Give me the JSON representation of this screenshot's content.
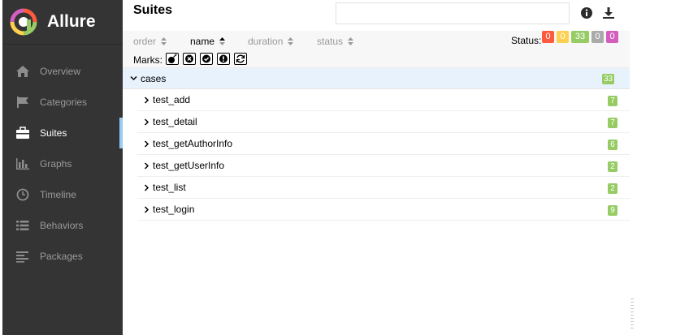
{
  "brand": {
    "name": "Allure"
  },
  "nav": [
    {
      "label": "Overview",
      "icon": "home-icon"
    },
    {
      "label": "Categories",
      "icon": "flag-icon"
    },
    {
      "label": "Suites",
      "icon": "briefcase-icon",
      "active": true
    },
    {
      "label": "Graphs",
      "icon": "bar-chart-icon"
    },
    {
      "label": "Timeline",
      "icon": "clock-icon"
    },
    {
      "label": "Behaviors",
      "icon": "list-icon"
    },
    {
      "label": "Packages",
      "icon": "align-left-icon"
    }
  ],
  "header": {
    "title": "Suites",
    "search_value": "",
    "info_icon": "info-icon",
    "download_icon": "download-icon"
  },
  "toolbar": {
    "sorters": [
      "order",
      "name",
      "duration",
      "status"
    ],
    "active_sorter": "name",
    "status_label": "Status:",
    "status_counts": [
      {
        "value": "0",
        "color": "#fd5a3e"
      },
      {
        "value": "0",
        "color": "#ffd050"
      },
      {
        "value": "33",
        "color": "#97cc64"
      },
      {
        "value": "0",
        "color": "#aaaaaa"
      },
      {
        "value": "0",
        "color": "#d35ebe"
      }
    ],
    "marks_label": "Marks:",
    "marks": [
      "bomb-icon",
      "times-circle-icon",
      "check-circle-icon",
      "exclamation-circle-icon",
      "refresh-icon"
    ]
  },
  "tree": {
    "group": {
      "name": "cases",
      "count": "33"
    },
    "items": [
      {
        "name": "test_add",
        "count": "7"
      },
      {
        "name": "test_detail",
        "count": "7"
      },
      {
        "name": "test_getAuthorInfo",
        "count": "6"
      },
      {
        "name": "test_getUserInfo",
        "count": "2"
      },
      {
        "name": "test_list",
        "count": "2"
      },
      {
        "name": "test_login",
        "count": "9"
      }
    ]
  },
  "colors": {
    "sidebar_bg": "#343434",
    "active_indicator": "#97cbf2",
    "passed": "#97cc64",
    "group_row_bg": "#e7f2fc"
  }
}
